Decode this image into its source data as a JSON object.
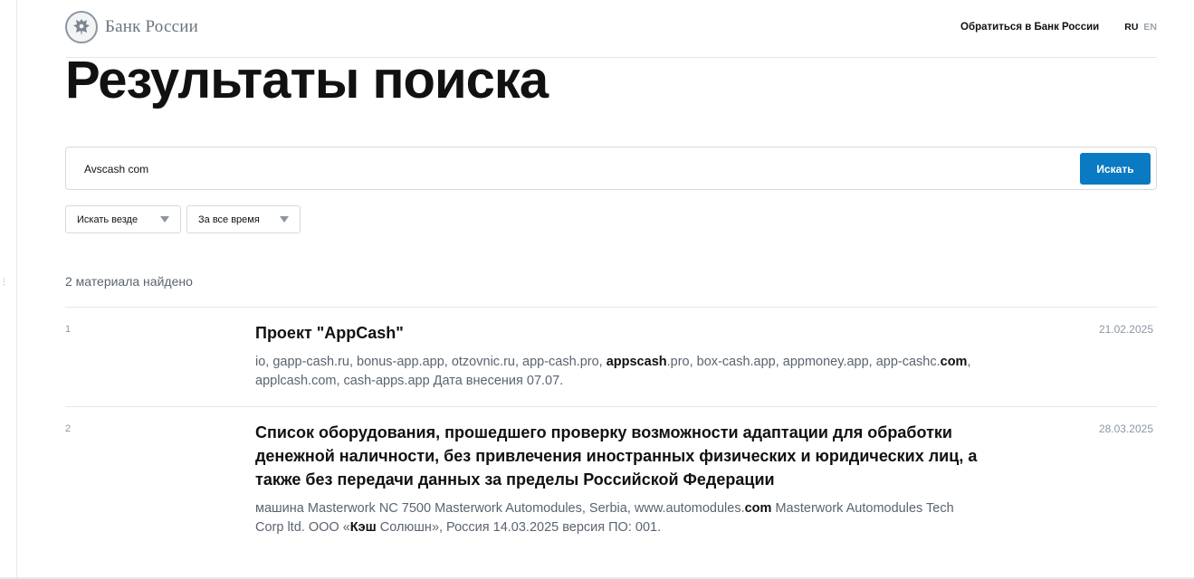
{
  "header": {
    "logo_text": "Банк России",
    "contact_link": "Обратиться в Банк России",
    "lang_ru": "RU",
    "lang_en": "EN"
  },
  "page_title": "Результаты поиска",
  "search": {
    "value": "Avscash com",
    "button_label": "Искать"
  },
  "filters": [
    {
      "label": "Искать везде"
    },
    {
      "label": "За все время"
    }
  ],
  "results_count": "2 материала найдено",
  "results": [
    {
      "number": "1",
      "title": "Проект \"AppCash\"",
      "date": "21.02.2025",
      "snippet": [
        {
          "text": "io, gapp-cash.ru, bonus-app.app, otzovnic.ru, app-cash.pro, ",
          "bold": false
        },
        {
          "text": "appscash",
          "bold": true
        },
        {
          "text": ".pro, box-cash.app, appmoney.app, app-cashc.",
          "bold": false
        },
        {
          "text": "com",
          "bold": true
        },
        {
          "text": ", applcash.com, cash-apps.app Дата внесения 07.07.",
          "bold": false
        }
      ]
    },
    {
      "number": "2",
      "title": "Список оборудования, прошедшего проверку возможности адаптации для обработки денежной наличности, без привлечения иностранных физических и юридических лиц, а также без передачи данных за пределы Российской Федерации",
      "date": "28.03.2025",
      "snippet": [
        {
          "text": "машина Masterwork NC 7500 Masterwork Automodules, Serbia, www.automodules.",
          "bold": false
        },
        {
          "text": "com",
          "bold": true
        },
        {
          "text": " Masterwork Automodules Tech Corp ltd. ООО «",
          "bold": false
        },
        {
          "text": "Кэш",
          "bold": true
        },
        {
          "text": " Солюшн», Россия 14.03.2025 версия ПО: 001.",
          "bold": false
        }
      ]
    }
  ]
}
